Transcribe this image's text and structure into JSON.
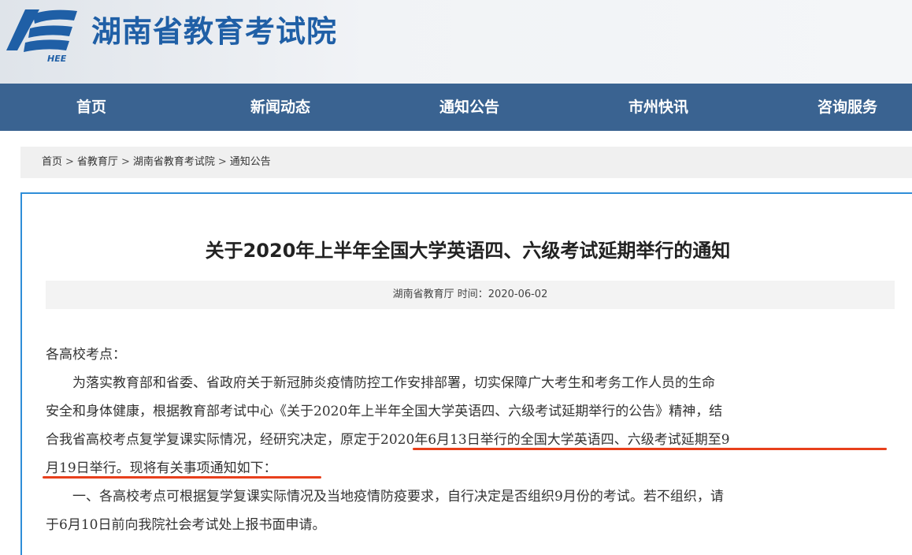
{
  "header": {
    "site_title": "湖南省教育考试院",
    "logo_text": "HEE"
  },
  "nav": {
    "items": [
      {
        "label": "首页"
      },
      {
        "label": "新闻动态"
      },
      {
        "label": "通知公告"
      },
      {
        "label": "市州快讯"
      },
      {
        "label": "咨询服务"
      }
    ]
  },
  "breadcrumb": {
    "items": [
      "首页",
      "省教育厅",
      "湖南省教育考试院",
      "通知公告"
    ],
    "separator": ">"
  },
  "article": {
    "title": "关于2020年上半年全国大学英语四、六级考试延期举行的通知",
    "meta": "湖南省教育厅 时间：2020-06-02",
    "lines": [
      "各高校考点：",
      "　　为落实教育部和省委、省政府关于新冠肺炎疫情防控工作安排部署，切实保障广大考生和考务工作人员的生命",
      "安全和身体健康，根据教育部考试中心《关于2020年上半年全国大学英语四、六级考试延期举行的公告》精神，结",
      "合我省高校考点复学复课实际情况，经研究决定，原定于2020年6月13日举行的全国大学英语四、六级考试延期至9",
      "月19日举行。现将有关事项通知如下：",
      "　　一、各高校考点可根据复学复课实际情况及当地疫情防疫要求，自行决定是否组织9月份的考试。若不组织，请",
      "于6月10日前向我院社会考试处上报书面申请。"
    ]
  },
  "colors": {
    "nav_bg": "#3a6391",
    "title_blue": "#1f5fa6",
    "content_border": "#2f8ed8",
    "highlight_underline": "#e8401c"
  }
}
